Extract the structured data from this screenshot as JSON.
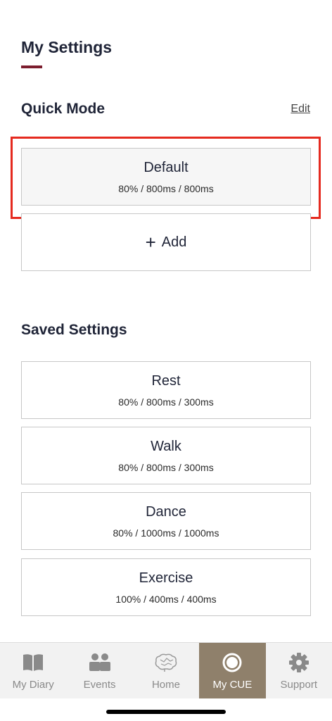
{
  "header": {
    "title": "My Settings"
  },
  "quick_mode": {
    "title": "Quick Mode",
    "edit_label": "Edit",
    "items": [
      {
        "name": "Default",
        "params": "80% / 800ms / 800ms",
        "selected": true
      }
    ],
    "add_label": "Add",
    "add_icon": "plus-icon"
  },
  "saved_settings": {
    "title": "Saved Settings",
    "items": [
      {
        "name": "Rest",
        "params": "80% / 800ms / 300ms"
      },
      {
        "name": "Walk",
        "params": "80% / 800ms / 300ms"
      },
      {
        "name": "Dance",
        "params": "80% / 1000ms / 1000ms"
      },
      {
        "name": "Exercise",
        "params": "100% / 400ms / 400ms"
      }
    ]
  },
  "tabbar": {
    "active_color": "#8f806b",
    "tabs": [
      {
        "label": "My Diary",
        "icon": "book-icon",
        "active": false
      },
      {
        "label": "Events",
        "icon": "people-icon",
        "active": false
      },
      {
        "label": "Home",
        "icon": "brain-icon",
        "active": false
      },
      {
        "label": "My CUE",
        "icon": "cue-ring-icon",
        "active": true
      },
      {
        "label": "Support",
        "icon": "gear-icon",
        "active": false
      }
    ]
  },
  "colors": {
    "accent_underline": "#7c1d2e",
    "highlight_border": "#e52a1f"
  }
}
